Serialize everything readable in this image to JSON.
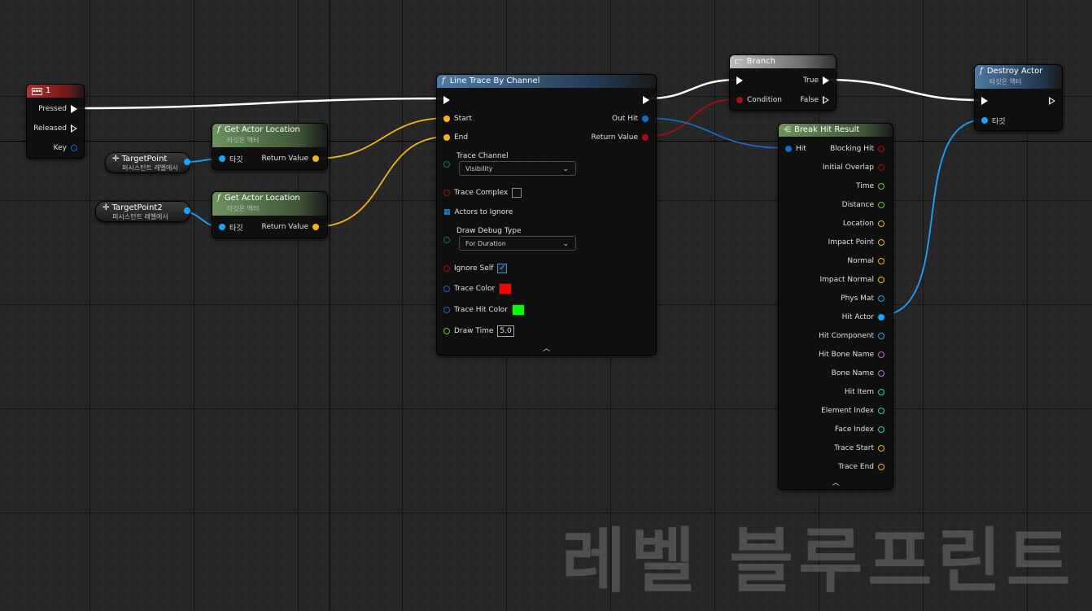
{
  "colors": {
    "exec": "#ffffff",
    "vector": "#f2b51c",
    "object": "#1aa3ff",
    "bool": "#a80f0f",
    "float": "#5fd02a",
    "struct": "#1869c4",
    "name": "#b36cd9",
    "int": "#1fd6b0",
    "byte": "#0e6f66"
  },
  "watermark": "레벨 블루프린트",
  "event_node": {
    "title": "1",
    "icon": "keyboard-icon",
    "pins": {
      "pressed": "Pressed",
      "released": "Released",
      "key": "Key"
    }
  },
  "get_actor_location_1": {
    "title": "Get Actor Location",
    "subtitle": "타깃은 액터",
    "pins": {
      "target": "타깃",
      "return_value": "Return Value"
    }
  },
  "get_actor_location_2": {
    "title": "Get Actor Location",
    "subtitle": "타깃은 액터",
    "pins": {
      "target": "타깃",
      "return_value": "Return Value"
    }
  },
  "var_target_point": {
    "name": "TargetPoint",
    "subtitle": "퍼시스턴트 레벨에서"
  },
  "var_target_point2": {
    "name": "TargetPoint2",
    "subtitle": "퍼시스턴트 레벨에서"
  },
  "line_trace": {
    "title": "Line Trace By Channel",
    "pins": {
      "start": "Start",
      "end": "End",
      "out_hit": "Out Hit",
      "return_value": "Return Value",
      "trace_channel": "Trace Channel",
      "trace_channel_value": "Visibility",
      "trace_complex": "Trace Complex",
      "actors_to_ignore": "Actors to Ignore",
      "draw_debug_type": "Draw Debug Type",
      "draw_debug_type_value": "For Duration",
      "ignore_self": "Ignore Self",
      "trace_color": "Trace Color",
      "trace_hit_color": "Trace Hit Color",
      "draw_time": "Draw Time",
      "draw_time_value": "5.0"
    },
    "trace_complex_checked": false,
    "ignore_self_checked": true,
    "trace_color_value": "#ff0000",
    "trace_hit_color_value": "#00ff00"
  },
  "branch": {
    "title": "Branch",
    "pins": {
      "condition": "Condition",
      "true": "True",
      "false": "False"
    }
  },
  "destroy_actor": {
    "title": "Destroy Actor",
    "subtitle": "타깃은 액터",
    "pins": {
      "target": "타깃"
    }
  },
  "break_hit_result": {
    "title": "Break Hit Result",
    "pins": {
      "hit": "Hit",
      "outputs": [
        "Blocking Hit",
        "Initial Overlap",
        "Time",
        "Distance",
        "Location",
        "Impact Point",
        "Normal",
        "Impact Normal",
        "Phys Mat",
        "Hit Actor",
        "Hit Component",
        "Hit Bone Name",
        "Bone Name",
        "Hit Item",
        "Element Index",
        "Face Index",
        "Trace Start",
        "Trace End"
      ]
    }
  }
}
